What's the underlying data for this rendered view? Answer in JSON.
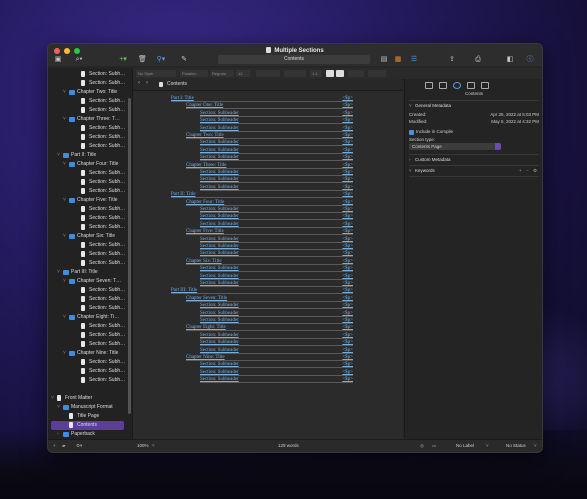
{
  "window": {
    "title": "Multiple Sections"
  },
  "toolbar": {
    "doc_field": "Contents"
  },
  "formatbar": {
    "style": "No Style",
    "font": "Palatino",
    "weight": "Regular",
    "size": "12",
    "line_spacing": "1.1"
  },
  "binder": {
    "items": [
      {
        "label": "Section: Subh…",
        "depth": 4,
        "kind": "doc"
      },
      {
        "label": "Section: Subh…",
        "depth": 4,
        "kind": "doc"
      },
      {
        "label": "Chapter Two: Title",
        "depth": 2,
        "kind": "folder",
        "tw": "v"
      },
      {
        "label": "Section: Subh…",
        "depth": 4,
        "kind": "doc"
      },
      {
        "label": "Section: Subh…",
        "depth": 4,
        "kind": "doc"
      },
      {
        "label": "Chapter Three: T…",
        "depth": 2,
        "kind": "folder",
        "tw": "v"
      },
      {
        "label": "Section: Subh…",
        "depth": 4,
        "kind": "doc"
      },
      {
        "label": "Section: Subh…",
        "depth": 4,
        "kind": "doc"
      },
      {
        "label": "Section: Subh…",
        "depth": 4,
        "kind": "doc"
      },
      {
        "label": "Part II: Title",
        "depth": 1,
        "kind": "folder",
        "tw": "v"
      },
      {
        "label": "Chapter Four: Title",
        "depth": 2,
        "kind": "folder",
        "tw": "v"
      },
      {
        "label": "Section: Subh…",
        "depth": 4,
        "kind": "doc"
      },
      {
        "label": "Section: Subh…",
        "depth": 4,
        "kind": "doc"
      },
      {
        "label": "Section: Subh…",
        "depth": 4,
        "kind": "doc"
      },
      {
        "label": "Chapter Five: Title",
        "depth": 2,
        "kind": "folder",
        "tw": "v"
      },
      {
        "label": "Section: Subh…",
        "depth": 4,
        "kind": "doc"
      },
      {
        "label": "Section: Subh…",
        "depth": 4,
        "kind": "doc"
      },
      {
        "label": "Section: Subh…",
        "depth": 4,
        "kind": "doc"
      },
      {
        "label": "Chapter Six: Title",
        "depth": 2,
        "kind": "folder",
        "tw": "v"
      },
      {
        "label": "Section: Subh…",
        "depth": 4,
        "kind": "doc"
      },
      {
        "label": "Section: Subh…",
        "depth": 4,
        "kind": "doc"
      },
      {
        "label": "Section: Subh…",
        "depth": 4,
        "kind": "doc"
      },
      {
        "label": "Part III: Title",
        "depth": 1,
        "kind": "folder",
        "tw": "v"
      },
      {
        "label": "Chapter Seven: T…",
        "depth": 2,
        "kind": "folder",
        "tw": "v"
      },
      {
        "label": "Section: Subh…",
        "depth": 4,
        "kind": "doc"
      },
      {
        "label": "Section: Subh…",
        "depth": 4,
        "kind": "doc"
      },
      {
        "label": "Section: Subh…",
        "depth": 4,
        "kind": "doc"
      },
      {
        "label": "Chapter Eight: Ti…",
        "depth": 2,
        "kind": "folder",
        "tw": "v"
      },
      {
        "label": "Section: Subh…",
        "depth": 4,
        "kind": "doc"
      },
      {
        "label": "Section: Subh…",
        "depth": 4,
        "kind": "doc"
      },
      {
        "label": "Section: Subh…",
        "depth": 4,
        "kind": "doc"
      },
      {
        "label": "Chapter Nine: Title",
        "depth": 2,
        "kind": "folder",
        "tw": "v"
      },
      {
        "label": "Section: Subh…",
        "depth": 4,
        "kind": "doc"
      },
      {
        "label": "Section: Subh…",
        "depth": 4,
        "kind": "doc"
      },
      {
        "label": "Section: Subh…",
        "depth": 4,
        "kind": "doc"
      },
      {
        "label": "",
        "depth": 0,
        "kind": "gap"
      },
      {
        "label": "Front Matter",
        "depth": 0,
        "kind": "doc",
        "tw": "v"
      },
      {
        "label": "Manuscript Format",
        "depth": 1,
        "kind": "folder",
        "tw": "v"
      },
      {
        "label": "Title Page",
        "depth": 2,
        "kind": "doc"
      },
      {
        "label": "Contents",
        "depth": 2,
        "kind": "doc",
        "selected": true
      },
      {
        "label": "Paperback",
        "depth": 1,
        "kind": "folder",
        "tw": ">"
      },
      {
        "label": "E-book",
        "depth": 1,
        "kind": "folder",
        "tw": ">"
      }
    ]
  },
  "editor": {
    "header_title": "Contents",
    "toc": [
      {
        "text": "Part I: Title",
        "level": 0,
        "page": "<$p>"
      },
      {
        "text": "Chapter One: Title",
        "level": 1,
        "page": "<$p>"
      },
      {
        "text": "Section: Subheader",
        "level": 2,
        "page": "<$p>"
      },
      {
        "text": "Section: Subheader",
        "level": 2,
        "page": "<$p>"
      },
      {
        "text": "Section: Subheader",
        "level": 2,
        "page": "<$p>"
      },
      {
        "text": "Chapter Two: Title",
        "level": 1,
        "page": "<$p>"
      },
      {
        "text": "Section: Subheader",
        "level": 2,
        "page": "<$p>"
      },
      {
        "text": "Section: Subheader",
        "level": 2,
        "page": "<$p>"
      },
      {
        "text": "Section: Subheader",
        "level": 2,
        "page": "<$p>"
      },
      {
        "text": "Chapter Three: Title",
        "level": 1,
        "page": "<$p>"
      },
      {
        "text": "Section: Subheader",
        "level": 2,
        "page": "<$p>"
      },
      {
        "text": "Section: Subheader",
        "level": 2,
        "page": "<$p>"
      },
      {
        "text": "Section: Subheader",
        "level": 2,
        "page": "<$p>"
      },
      {
        "text": "Part II: Title",
        "level": 0,
        "page": "<$p>"
      },
      {
        "text": "Chapter Four: Title",
        "level": 1,
        "page": "<$p>"
      },
      {
        "text": "Section: Subheader",
        "level": 2,
        "page": "<$p>"
      },
      {
        "text": "Section: Subheader",
        "level": 2,
        "page": "<$p>"
      },
      {
        "text": "Section: Subheader",
        "level": 2,
        "page": "<$p>"
      },
      {
        "text": "Chapter Five: Title",
        "level": 1,
        "page": "<$p>"
      },
      {
        "text": "Section: Subheader",
        "level": 2,
        "page": "<$p>"
      },
      {
        "text": "Section: Subheader",
        "level": 2,
        "page": "<$p>"
      },
      {
        "text": "Section: Subheader",
        "level": 2,
        "page": "<$p>"
      },
      {
        "text": "Chapter Six: Title",
        "level": 1,
        "page": "<$p>"
      },
      {
        "text": "Section: Subheader",
        "level": 2,
        "page": "<$p>"
      },
      {
        "text": "Section: Subheader",
        "level": 2,
        "page": "<$p>"
      },
      {
        "text": "Section: Subheader",
        "level": 2,
        "page": "<$p>"
      },
      {
        "text": "Part III: Title",
        "level": 0,
        "page": "<$p>"
      },
      {
        "text": "Chapter Seven: Title",
        "level": 1,
        "page": "<$p>"
      },
      {
        "text": "Section: Subheader",
        "level": 2,
        "page": "<$p>"
      },
      {
        "text": "Section: Subheader",
        "level": 2,
        "page": "<$p>"
      },
      {
        "text": "Section: Subheader",
        "level": 2,
        "page": "<$p>"
      },
      {
        "text": "Chapter Eight: Title",
        "level": 1,
        "page": "<$p>"
      },
      {
        "text": "Section: Subheader",
        "level": 2,
        "page": "<$p>"
      },
      {
        "text": "Section: Subheader",
        "level": 2,
        "page": "<$p>"
      },
      {
        "text": "Section: Subheader",
        "level": 2,
        "page": "<$p>"
      },
      {
        "text": "Chapter Nine: Title",
        "level": 1,
        "page": "<$p>"
      },
      {
        "text": "Section: Subheader",
        "level": 2,
        "page": "<$p>"
      },
      {
        "text": "Section: Subheader",
        "level": 2,
        "page": "<$p>"
      },
      {
        "text": "Section: Subheader",
        "level": 2,
        "page": "<$p>"
      }
    ]
  },
  "inspector": {
    "title": "Contents",
    "section_general": "General Metadata",
    "created_label": "Created:",
    "created_value": "Apr 25, 2022 at 5:03 PM",
    "modified_label": "Modified:",
    "modified_value": "May 5, 2022 at 4:32 PM",
    "include_label": "Include in Compile",
    "section_type_label": "Section type:",
    "section_type_value": "Contents Page",
    "custom_metadata": "Custom Metadata",
    "keywords": "Keywords"
  },
  "footer": {
    "zoom": "100%",
    "word_count": "129 words",
    "label": "No Label",
    "status": "No Status"
  },
  "colors": {
    "accent": "#5b3e9c",
    "folder": "#3d8de0",
    "link": "#7aaedc",
    "light_red": "#ff5f57",
    "light_yellow": "#febc2e",
    "light_green": "#28c840"
  }
}
